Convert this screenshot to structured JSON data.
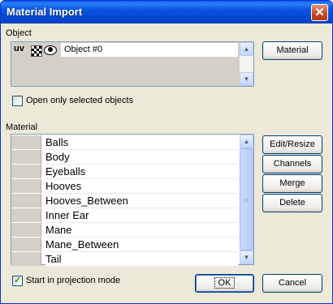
{
  "window": {
    "title": "Material Import"
  },
  "object_section": {
    "label": "Object",
    "items": [
      {
        "uv": "uv",
        "name": "Object #0"
      }
    ],
    "material_button": "Material",
    "open_selected_label": "Open only selected objects",
    "open_selected_checked": false
  },
  "material_section": {
    "label": "Material",
    "materials": [
      "Balls",
      "Body",
      "Eyeballs",
      "Hooves",
      "Hooves_Between",
      "Inner Ear",
      "Mane",
      "Mane_Between",
      "Tail"
    ],
    "buttons": {
      "edit_resize": "Edit/Resize",
      "channels": "Channels",
      "merge": "Merge",
      "delete": "Delete"
    }
  },
  "footer": {
    "projection_label": "Start in projection mode",
    "projection_checked": true,
    "ok": "OK",
    "cancel": "Cancel"
  },
  "colors": {
    "title_bar": "#0a55e0",
    "dialog_bg": "#ece9d8",
    "swatch": "#d4d0c8"
  },
  "icons": {
    "close": "close-icon",
    "checker": "checker-icon",
    "eye": "eye-icon"
  }
}
